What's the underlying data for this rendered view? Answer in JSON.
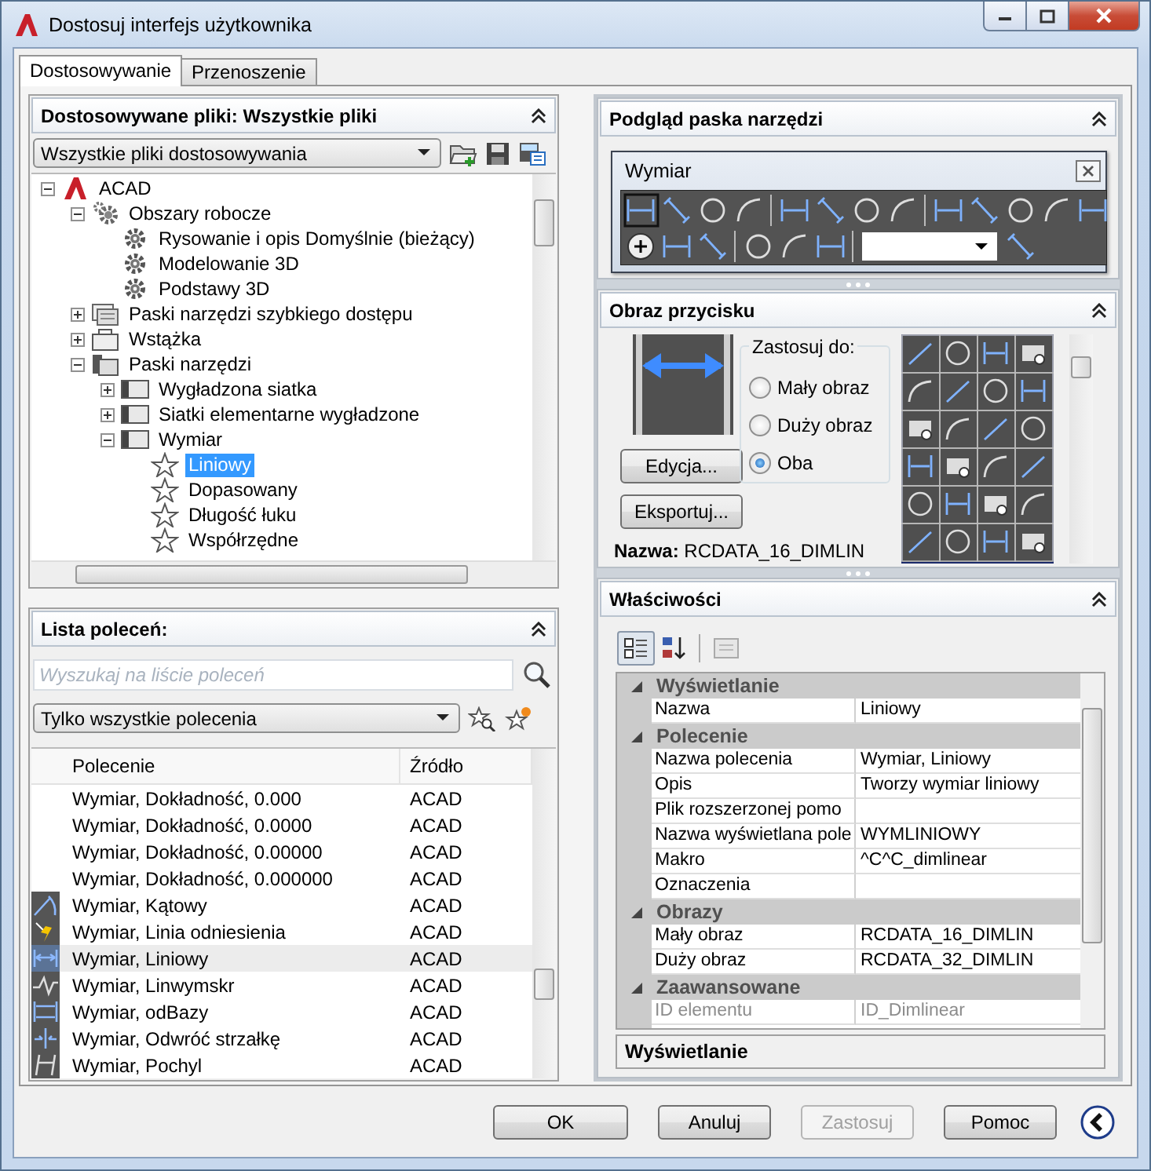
{
  "window": {
    "title": "Dostosuj interfejs użytkownika"
  },
  "tabs": [
    {
      "label": "Dostosowywanie",
      "selected": true
    },
    {
      "label": "Przenoszenie",
      "selected": false
    }
  ],
  "files_panel": {
    "title": "Dostosowywane pliki: Wszystkie pliki",
    "dropdown": "Wszystkie pliki dostosowywania",
    "tree": [
      {
        "label": "ACAD",
        "kind": "app",
        "expanded": true,
        "selected": false,
        "children": [
          {
            "label": "Obszary robocze",
            "kind": "workspaces",
            "expanded": true,
            "selected": false,
            "children": [
              {
                "label": "Rysowanie i opis Domyślnie (bieżący)",
                "kind": "workspace",
                "selected": false
              },
              {
                "label": "Modelowanie 3D",
                "kind": "workspace",
                "selected": false
              },
              {
                "label": "Podstawy 3D",
                "kind": "workspace",
                "selected": false
              }
            ]
          },
          {
            "label": "Paski narzędzi szybkiego dostępu",
            "kind": "quick",
            "expanded": false,
            "selected": false
          },
          {
            "label": "Wstążka",
            "kind": "ribbon",
            "expanded": false,
            "selected": false
          },
          {
            "label": "Paski narzędzi",
            "kind": "toolbars",
            "expanded": true,
            "selected": false,
            "children": [
              {
                "label": "Wygładzona siatka",
                "kind": "toolbar",
                "expanded": false,
                "selected": false
              },
              {
                "label": "Siatki elementarne wygładzone",
                "kind": "toolbar",
                "expanded": false,
                "selected": false
              },
              {
                "label": "Wymiar",
                "kind": "toolbar",
                "expanded": true,
                "selected": false,
                "children": [
                  {
                    "label": "Liniowy",
                    "kind": "command",
                    "selected": true
                  },
                  {
                    "label": "Dopasowany",
                    "kind": "command",
                    "selected": false
                  },
                  {
                    "label": "Długość łuku",
                    "kind": "command",
                    "selected": false
                  },
                  {
                    "label": "Współrzędne",
                    "kind": "command",
                    "selected": false
                  }
                ]
              }
            ]
          }
        ]
      }
    ]
  },
  "commands_panel": {
    "title": "Lista poleceń:",
    "search": {
      "placeholder": "Wyszukaj na liście poleceń"
    },
    "filter": "Tylko wszystkie polecenia",
    "columns": [
      "Polecenie",
      "Źródło"
    ],
    "rows": [
      {
        "name": "Wymiar, Dokładność, 0.000",
        "source": "ACAD",
        "kind": "plain",
        "selected": false
      },
      {
        "name": "Wymiar, Dokładność, 0.0000",
        "source": "ACAD",
        "kind": "plain",
        "selected": false
      },
      {
        "name": "Wymiar, Dokładność, 0.00000",
        "source": "ACAD",
        "kind": "plain",
        "selected": false
      },
      {
        "name": "Wymiar, Dokładność, 0.000000",
        "source": "ACAD",
        "kind": "plain",
        "selected": false
      },
      {
        "name": "Wymiar, Kątowy",
        "source": "ACAD",
        "kind": "angular",
        "selected": false
      },
      {
        "name": "Wymiar, Linia odniesienia",
        "source": "ACAD",
        "kind": "leader",
        "selected": false
      },
      {
        "name": "Wymiar, Liniowy",
        "source": "ACAD",
        "kind": "linear",
        "selected": true
      },
      {
        "name": "Wymiar, Linwymskr",
        "source": "ACAD",
        "kind": "jogged",
        "selected": false
      },
      {
        "name": "Wymiar, odBazy",
        "source": "ACAD",
        "kind": "baseline",
        "selected": false
      },
      {
        "name": "Wymiar, Odwróć strzałkę",
        "source": "ACAD",
        "kind": "flip",
        "selected": false
      },
      {
        "name": "Wymiar, Pochyl",
        "source": "ACAD",
        "kind": "oblique",
        "selected": false
      }
    ]
  },
  "toolbar_preview": {
    "title": "Podgląd paska narzędzi",
    "toolbar_name": "Wymiar"
  },
  "button_image": {
    "title": "Obraz przycisku",
    "apply_to": "Zastosuj do:",
    "options": [
      {
        "label": "Mały obraz",
        "selected": false
      },
      {
        "label": "Duży obraz",
        "selected": false
      },
      {
        "label": "Oba",
        "selected": true
      }
    ],
    "buttons": [
      "Edycja...",
      "Eksportuj..."
    ],
    "name": "**Nazwa:** RCDATA_16_DIMLIN"
  },
  "properties": {
    "title": "Właściwości",
    "rows": [
      {
        "kind": "category",
        "label": "Wyświetlanie"
      },
      {
        "kind": "property",
        "label": "Nazwa",
        "value": "Liniowy",
        "disabled": false
      },
      {
        "kind": "category",
        "label": "Polecenie"
      },
      {
        "kind": "property",
        "label": "Nazwa polecenia",
        "value": "Wymiar, Liniowy",
        "disabled": false
      },
      {
        "kind": "property",
        "label": "Opis",
        "value": "Tworzy wymiar liniowy",
        "disabled": false
      },
      {
        "kind": "property",
        "label": "Plik rozszerzonej pomo",
        "disabled": false
      },
      {
        "kind": "property",
        "label": "Nazwa wyświetlana pole",
        "value": "WYMLINIOWY",
        "disabled": false
      },
      {
        "kind": "property",
        "label": "Makro",
        "value": "^C^C_dimlinear",
        "disabled": false
      },
      {
        "kind": "property",
        "label": "Oznaczenia",
        "disabled": false
      },
      {
        "kind": "category",
        "label": "Obrazy"
      },
      {
        "kind": "property",
        "label": "Mały obraz",
        "value": "RCDATA_16_DIMLIN",
        "disabled": false
      },
      {
        "kind": "property",
        "label": "Duży obraz",
        "value": "RCDATA_32_DIMLIN",
        "disabled": false
      },
      {
        "kind": "category",
        "label": "Zaawansowane"
      },
      {
        "kind": "property",
        "label": "ID elementu",
        "value": "ID_Dimlinear",
        "disabled": true
      }
    ],
    "description": "Wyświetlanie"
  },
  "footer_buttons": [
    {
      "label": "OK",
      "disabled": false
    },
    {
      "label": "Anuluj",
      "disabled": false
    },
    {
      "label": "Zastosuj",
      "disabled": true
    },
    {
      "label": "Pomoc",
      "disabled": false
    }
  ]
}
